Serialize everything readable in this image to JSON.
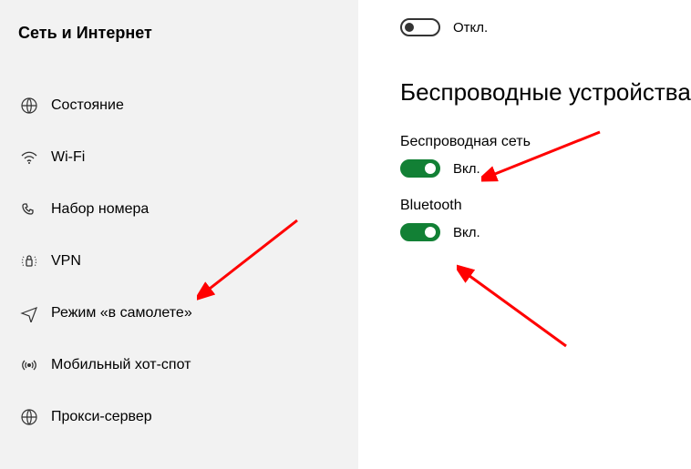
{
  "sidebar": {
    "heading": "Сеть и Интернет",
    "items": [
      {
        "label": "Состояние"
      },
      {
        "label": "Wi-Fi"
      },
      {
        "label": "Набор номера"
      },
      {
        "label": "VPN"
      },
      {
        "label": "Режим «в самолете»"
      },
      {
        "label": "Мобильный хот-спот"
      },
      {
        "label": "Прокси-сервер"
      }
    ]
  },
  "main": {
    "top_toggle": {
      "state_label": "Откл."
    },
    "section_title": "Беспроводные устройства",
    "wifi": {
      "label": "Беспроводная сеть",
      "state_label": "Вкл."
    },
    "bluetooth": {
      "label": "Bluetooth",
      "state_label": "Вкл."
    }
  },
  "colors": {
    "accent_on": "#128035",
    "arrow": "#ff0000"
  }
}
